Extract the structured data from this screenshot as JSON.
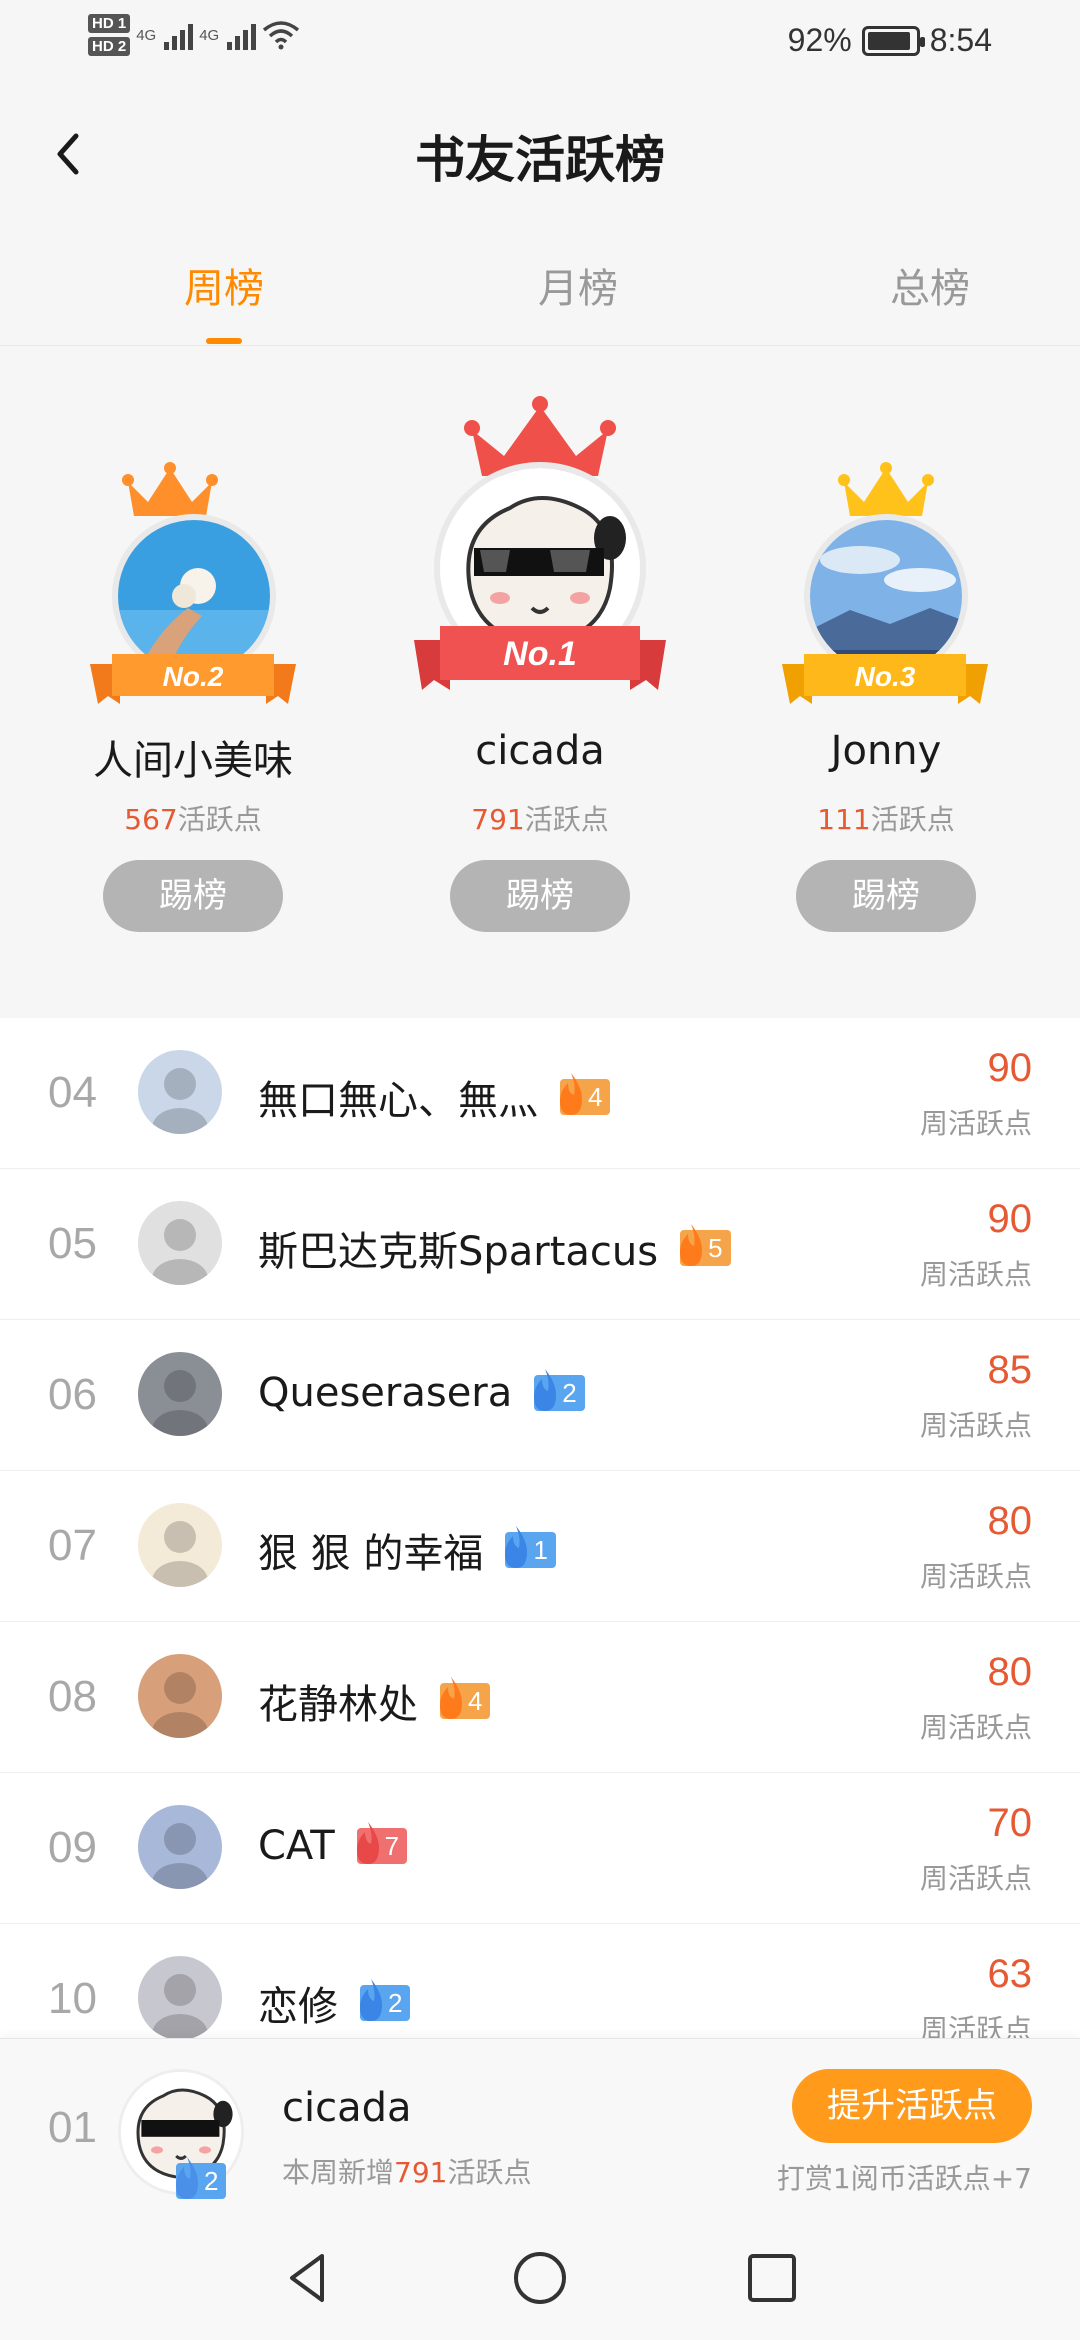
{
  "status_bar": {
    "hd1": "HD 1",
    "hd2": "HD 2",
    "net1": "4G",
    "net2": "4G",
    "battery": "92%",
    "time": "8:54"
  },
  "header": {
    "title": "书友活跃榜"
  },
  "tabs": [
    {
      "label": "周榜",
      "active": true
    },
    {
      "label": "月榜",
      "active": false
    },
    {
      "label": "总榜",
      "active": false
    }
  ],
  "podium": [
    {
      "place": "No.1",
      "name": "cicada",
      "score": "791",
      "unit": "活跃点",
      "button": "踢榜"
    },
    {
      "place": "No.2",
      "name": "人间小美味",
      "score": "567",
      "unit": "活跃点",
      "button": "踢榜"
    },
    {
      "place": "No.3",
      "name": "Jonny",
      "score": "111",
      "unit": "活跃点",
      "button": "踢榜"
    }
  ],
  "list": [
    {
      "rank": "04",
      "name": "無口無心、無灬",
      "level": "4",
      "badge_color": "orange",
      "score": "90",
      "unit": "周活跃点"
    },
    {
      "rank": "05",
      "name": "斯巴达克斯Spartacus",
      "level": "5",
      "badge_color": "orange",
      "score": "90",
      "unit": "周活跃点"
    },
    {
      "rank": "06",
      "name": "Queserasera",
      "level": "2",
      "badge_color": "blue",
      "score": "85",
      "unit": "周活跃点"
    },
    {
      "rank": "07",
      "name": "狠 狠 的幸福",
      "level": "1",
      "badge_color": "blue",
      "score": "80",
      "unit": "周活跃点"
    },
    {
      "rank": "08",
      "name": "花静林处",
      "level": "4",
      "badge_color": "orange",
      "score": "80",
      "unit": "周活跃点"
    },
    {
      "rank": "09",
      "name": "CAT",
      "level": "7",
      "badge_color": "red",
      "score": "70",
      "unit": "周活跃点"
    },
    {
      "rank": "10",
      "name": "恋修",
      "level": "2",
      "badge_color": "blue",
      "score": "63",
      "unit": "周活跃点"
    }
  ],
  "self": {
    "rank": "01",
    "name": "cicada",
    "level": "2",
    "desc_prefix": "本周新增",
    "desc_num": "791",
    "desc_suffix": "活跃点",
    "button": "提升活跃点",
    "note": "打赏1阅币活跃点+7"
  },
  "colors": {
    "accent": "#ff8a00",
    "score": "#e65a33",
    "badge_orange": "#f5a44a",
    "badge_blue": "#5aa5f0",
    "badge_red": "#f07070"
  }
}
